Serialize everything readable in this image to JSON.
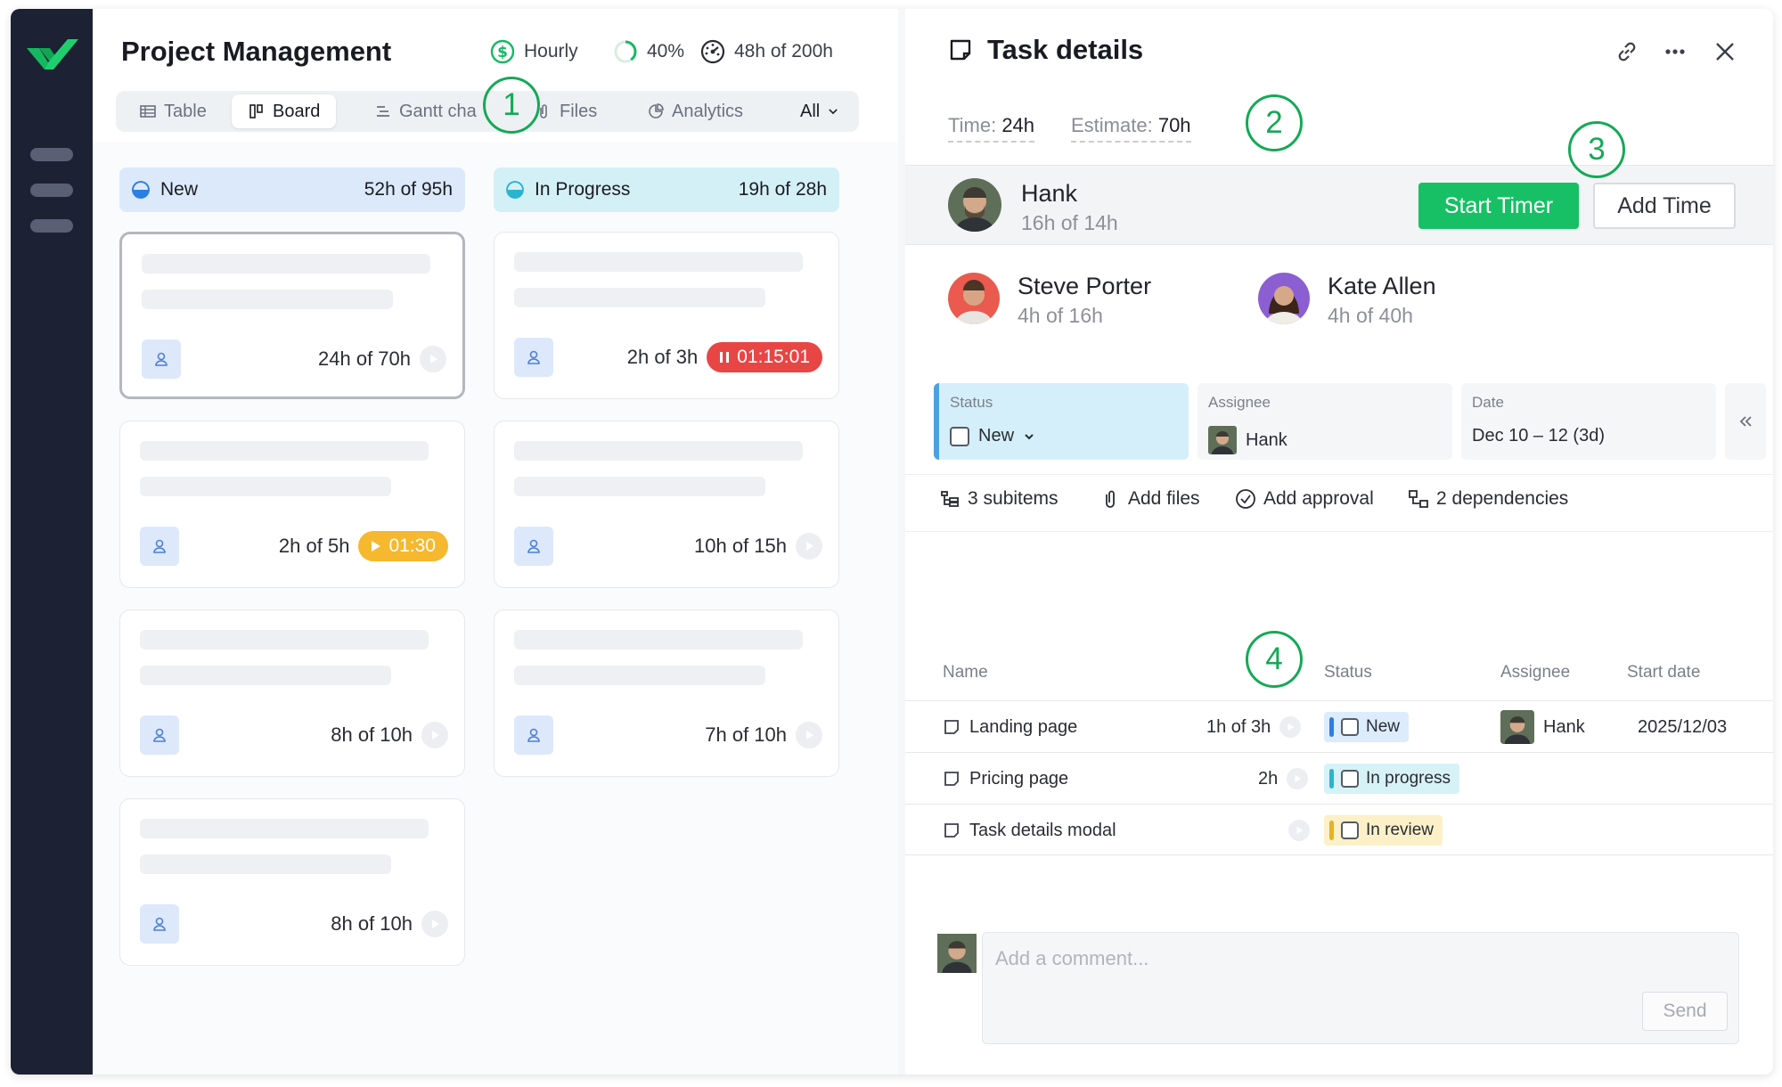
{
  "app": {
    "accent": "#17c065",
    "sidebar_color": "#1d2134"
  },
  "header": {
    "title": "Project Management",
    "billing": "Hourly",
    "progress": "40%",
    "progress_value": 0.4,
    "hours": "48h of 200h"
  },
  "tabs": [
    {
      "label": "Table",
      "icon": "table-icon"
    },
    {
      "label": "Board",
      "icon": "board-icon",
      "active": true
    },
    {
      "label": "Gantt cha",
      "icon": "gantt-icon"
    },
    {
      "label": "Files",
      "icon": "paperclip-icon"
    },
    {
      "label": "Analytics",
      "icon": "analytics-icon"
    }
  ],
  "tabs_more": "All",
  "columns": [
    {
      "name": "New",
      "hours": "52h of 95h",
      "color": "#dbe9fb",
      "dot": "#2b7fe0",
      "cards": [
        {
          "time": "24h of 70h"
        },
        {
          "time": "2h of 5h",
          "timer": "01:30",
          "timer_color": "#f5b82e"
        },
        {
          "time": "8h of 10h"
        },
        {
          "time": "8h of 10h"
        }
      ]
    },
    {
      "name": "In Progress",
      "hours": "19h of 28h",
      "color": "#d3f0f6",
      "dot": "#2cb4cf",
      "cards": [
        {
          "time": "2h of 3h",
          "timer": "01:15:01",
          "timer_color": "#e84545"
        },
        {
          "time": "10h of 15h"
        },
        {
          "time": "7h of 10h"
        }
      ]
    }
  ],
  "details": {
    "title": "Task details",
    "time_label": "Time:",
    "time_value": "24h",
    "estimate_label": "Estimate:",
    "estimate_value": "70h",
    "owner": {
      "name": "Hank",
      "hours": "16h of 14h"
    },
    "start_timer": "Start Timer",
    "add_time": "Add Time",
    "people": [
      {
        "name": "Steve Porter",
        "hours": "4h of 16h"
      },
      {
        "name": "Kate Allen",
        "hours": "4h of 40h"
      }
    ],
    "fields": {
      "status_label": "Status",
      "status_value": "New",
      "assignee_label": "Assignee",
      "assignee_value": "Hank",
      "date_label": "Date",
      "date_value": "Dec 10 – 12 (3d)"
    },
    "actions": {
      "subitems": "3 subitems",
      "files": "Add files",
      "approval": "Add approval",
      "dependencies": "2 dependencies"
    },
    "table": {
      "headers": {
        "name": "Name",
        "status": "Status",
        "assignee": "Assignee",
        "start": "Start date"
      },
      "rows": [
        {
          "name": "Landing page",
          "time": "1h of 3h",
          "status": "New",
          "status_bg": "#dcecfd",
          "status_bar": "#2b7fe0",
          "assignee": "Hank",
          "start": "2025/12/03"
        },
        {
          "name": "Pricing page",
          "time": "2h",
          "status": "In progress",
          "status_bg": "#d6f2f7",
          "status_bar": "#2cb4cf",
          "assignee": "",
          "start": ""
        },
        {
          "name": "Task details modal",
          "time": "",
          "status": "In review",
          "status_bg": "#fbf0c8",
          "status_bar": "#e3b521",
          "assignee": "",
          "start": ""
        }
      ]
    },
    "comment_placeholder": "Add a comment...",
    "send": "Send"
  },
  "markers": [
    "1",
    "2",
    "3",
    "4"
  ]
}
